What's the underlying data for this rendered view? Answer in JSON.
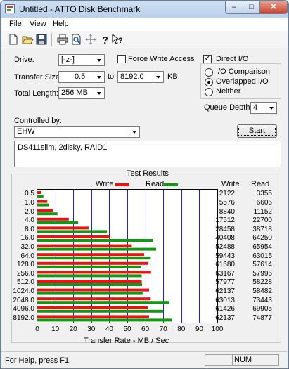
{
  "window": {
    "title": "Untitled - ATTO Disk Benchmark"
  },
  "menu": [
    "File",
    "View",
    "Help"
  ],
  "toolbar_icons": [
    "new-icon",
    "open-icon",
    "save-icon",
    "print-icon",
    "print-preview-icon",
    "move-icon",
    "help-icon",
    "context-help-icon"
  ],
  "settings": {
    "drive_label": "Drive:",
    "drive_value": "[-z-]",
    "force_write_label": "Force Write Access",
    "force_write_checked": false,
    "direct_io_label": "Direct I/O",
    "direct_io_checked": true,
    "transfer_size_label": "Transfer Size:",
    "transfer_from": "0.5",
    "to_label": "to",
    "transfer_to": "8192.0",
    "kb_label": "KB",
    "total_length_label": "Total Length:",
    "total_length_value": "256 MB",
    "io_comparison_label": "I/O Comparison",
    "overlapped_io_label": "Overlapped I/O",
    "neither_label": "Neither",
    "selected_mode": "Overlapped I/O",
    "queue_depth_label": "Queue Depth:",
    "queue_depth_value": "4",
    "controlled_by_label": "Controlled by:",
    "controlled_by_value": "EHW",
    "start_label": "Start",
    "description": "DS411slim, 2disky, RAID1"
  },
  "results": {
    "title": "Test Results",
    "write_label": "Write",
    "read_label": "Read",
    "write_color": "#ee1111",
    "read_color": "#119911",
    "column_write": "Write",
    "column_read": "Read"
  },
  "chart_data": {
    "type": "bar",
    "orientation": "horizontal",
    "xlabel": "Transfer Rate - MB / Sec",
    "xlim": [
      0,
      100
    ],
    "xticks": [
      "0",
      "10",
      "20",
      "30",
      "40",
      "50",
      "60",
      "70",
      "80",
      "90",
      "100"
    ],
    "categories": [
      "0.5",
      "1.0",
      "2.0",
      "4.0",
      "8.0",
      "16.0",
      "32.0",
      "64.0",
      "128.0",
      "256.0",
      "512.0",
      "1024.0",
      "2048.0",
      "4096.0",
      "8192.0"
    ],
    "series": [
      {
        "name": "Write",
        "values": [
          2.1,
          5.6,
          8.8,
          17.5,
          28.5,
          40.4,
          52.5,
          59.4,
          61.7,
          63.2,
          58.0,
          62.1,
          63.0,
          61.4,
          62.1
        ]
      },
      {
        "name": "Read",
        "values": [
          3.4,
          6.6,
          11.2,
          22.7,
          38.7,
          64.3,
          66.0,
          63.0,
          57.6,
          58.0,
          58.2,
          58.5,
          73.4,
          69.9,
          74.9
        ]
      }
    ],
    "write_values_text": [
      "2122",
      "5576",
      "8840",
      "17512",
      "28458",
      "40408",
      "52488",
      "59443",
      "61680",
      "63167",
      "57977",
      "62137",
      "63013",
      "61426",
      "62137"
    ],
    "read_values_text": [
      "3355",
      "6606",
      "11152",
      "22700",
      "38718",
      "64250",
      "65954",
      "63015",
      "57614",
      "57996",
      "58228",
      "58482",
      "73443",
      "69905",
      "74877"
    ]
  },
  "status": {
    "text": "For Help, press F1",
    "num": "NUM"
  }
}
